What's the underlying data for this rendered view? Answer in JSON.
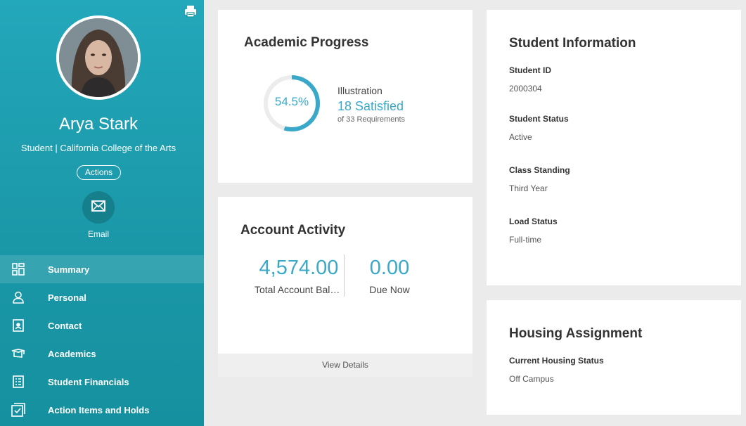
{
  "sidebar": {
    "user_name": "Arya Stark",
    "user_subtitle": "Student | California College of the Arts",
    "actions_label": "Actions",
    "email_label": "Email",
    "nav": [
      {
        "label": "Summary",
        "icon": "dashboard-grid-icon",
        "active": true
      },
      {
        "label": "Personal",
        "icon": "person-icon",
        "active": false
      },
      {
        "label": "Contact",
        "icon": "contact-card-icon",
        "active": false
      },
      {
        "label": "Academics",
        "icon": "mortarboard-icon",
        "active": false
      },
      {
        "label": "Student Financials",
        "icon": "document-list-icon",
        "active": false
      },
      {
        "label": "Action Items and Holds",
        "icon": "checklist-icon",
        "active": false
      }
    ]
  },
  "academic_progress": {
    "title": "Academic Progress",
    "percent_label": "54.5%",
    "percent_value": 54.5,
    "program": "Illustration",
    "satisfied": "18 Satisfied",
    "requirements": "of 33 Requirements"
  },
  "account_activity": {
    "title": "Account Activity",
    "balance": "4,574.00",
    "balance_label": "Total Account Balance",
    "due": "0.00",
    "due_label": "Due Now",
    "view_details": "View Details"
  },
  "student_info": {
    "title": "Student Information",
    "fields": [
      {
        "label": "Student ID",
        "value": "2000304"
      },
      {
        "label": "Student Status",
        "value": "Active"
      },
      {
        "label": "Class Standing",
        "value": "Third Year"
      },
      {
        "label": "Load Status",
        "value": "Full-time"
      }
    ]
  },
  "housing": {
    "title": "Housing Assignment",
    "label": "Current Housing Status",
    "value": "Off Campus"
  },
  "colors": {
    "accent": "#3aa9c9",
    "sidebar": "#1a97a7"
  }
}
